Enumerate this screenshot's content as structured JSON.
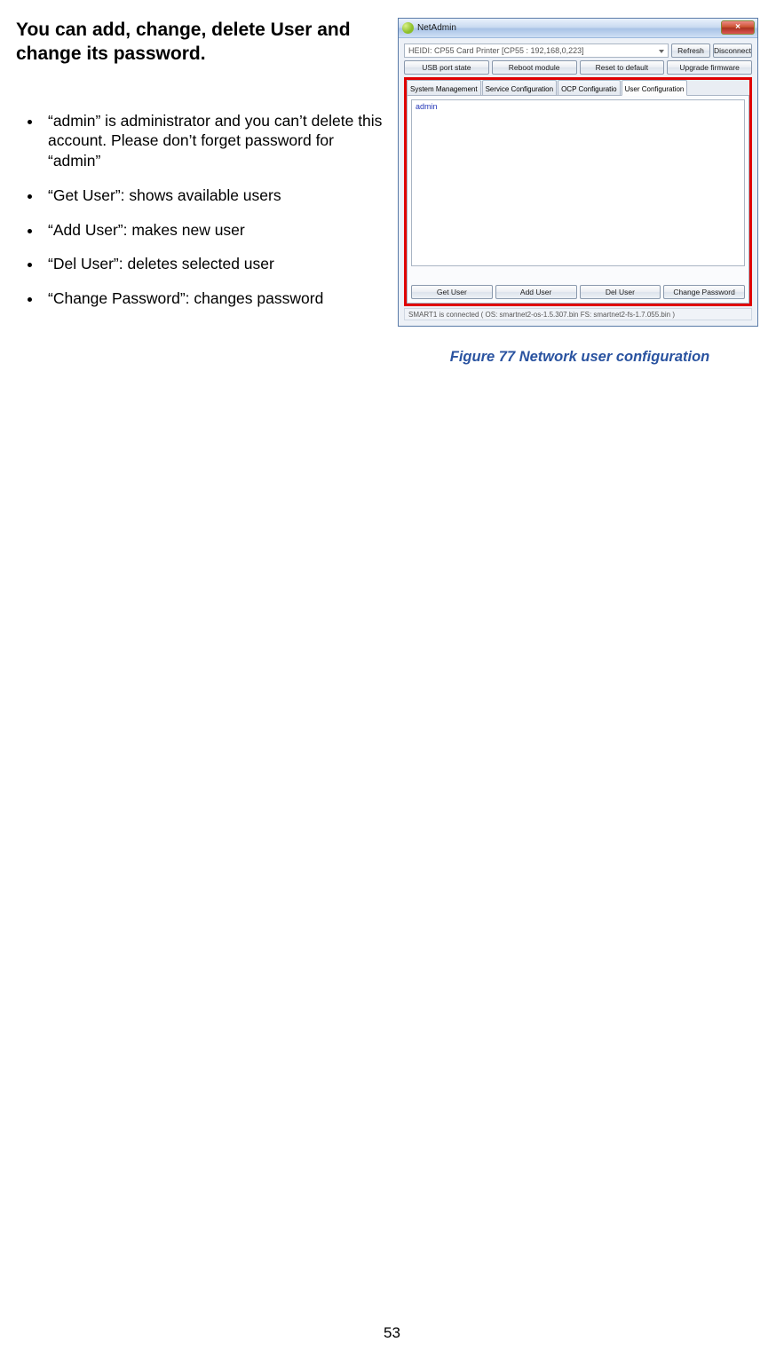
{
  "left": {
    "heading": "You can add, change, delete User and change its password.",
    "bullets": [
      "“admin” is administrator and you can’t delete this account. Please don’t forget password for “admin”",
      "“Get User”: shows available users",
      "“Add User”: makes new user",
      "“Del User”: deletes selected user",
      "“Change Password”: changes password"
    ]
  },
  "app": {
    "title": "NetAdmin",
    "close_x": "×",
    "combo_text": "HEIDI: CP55 Card Printer [CP55 : 192,168,0,223]",
    "top_btns": {
      "refresh": "Refresh",
      "disconnect": "Disconnect"
    },
    "toolbar": {
      "usb": "USB port state",
      "reboot": "Reboot module",
      "reset": "Reset to default",
      "upgrade": "Upgrade firmware"
    },
    "tabs": {
      "sys": "System Management",
      "svc": "Service Configuration",
      "dcp": "OCP Configuratio",
      "user": "User Configuration"
    },
    "list": {
      "item0": "admin"
    },
    "bottom": {
      "get": "Get User",
      "add": "Add User",
      "del": "Del User",
      "chpw": "Change Password"
    },
    "status": "SMART1 is connected ( OS: smartnet2-os-1.5.307.bin  FS: smartnet2-fs-1.7.055.bin )"
  },
  "caption": "Figure 77 Network user configuration",
  "page_num": "53"
}
